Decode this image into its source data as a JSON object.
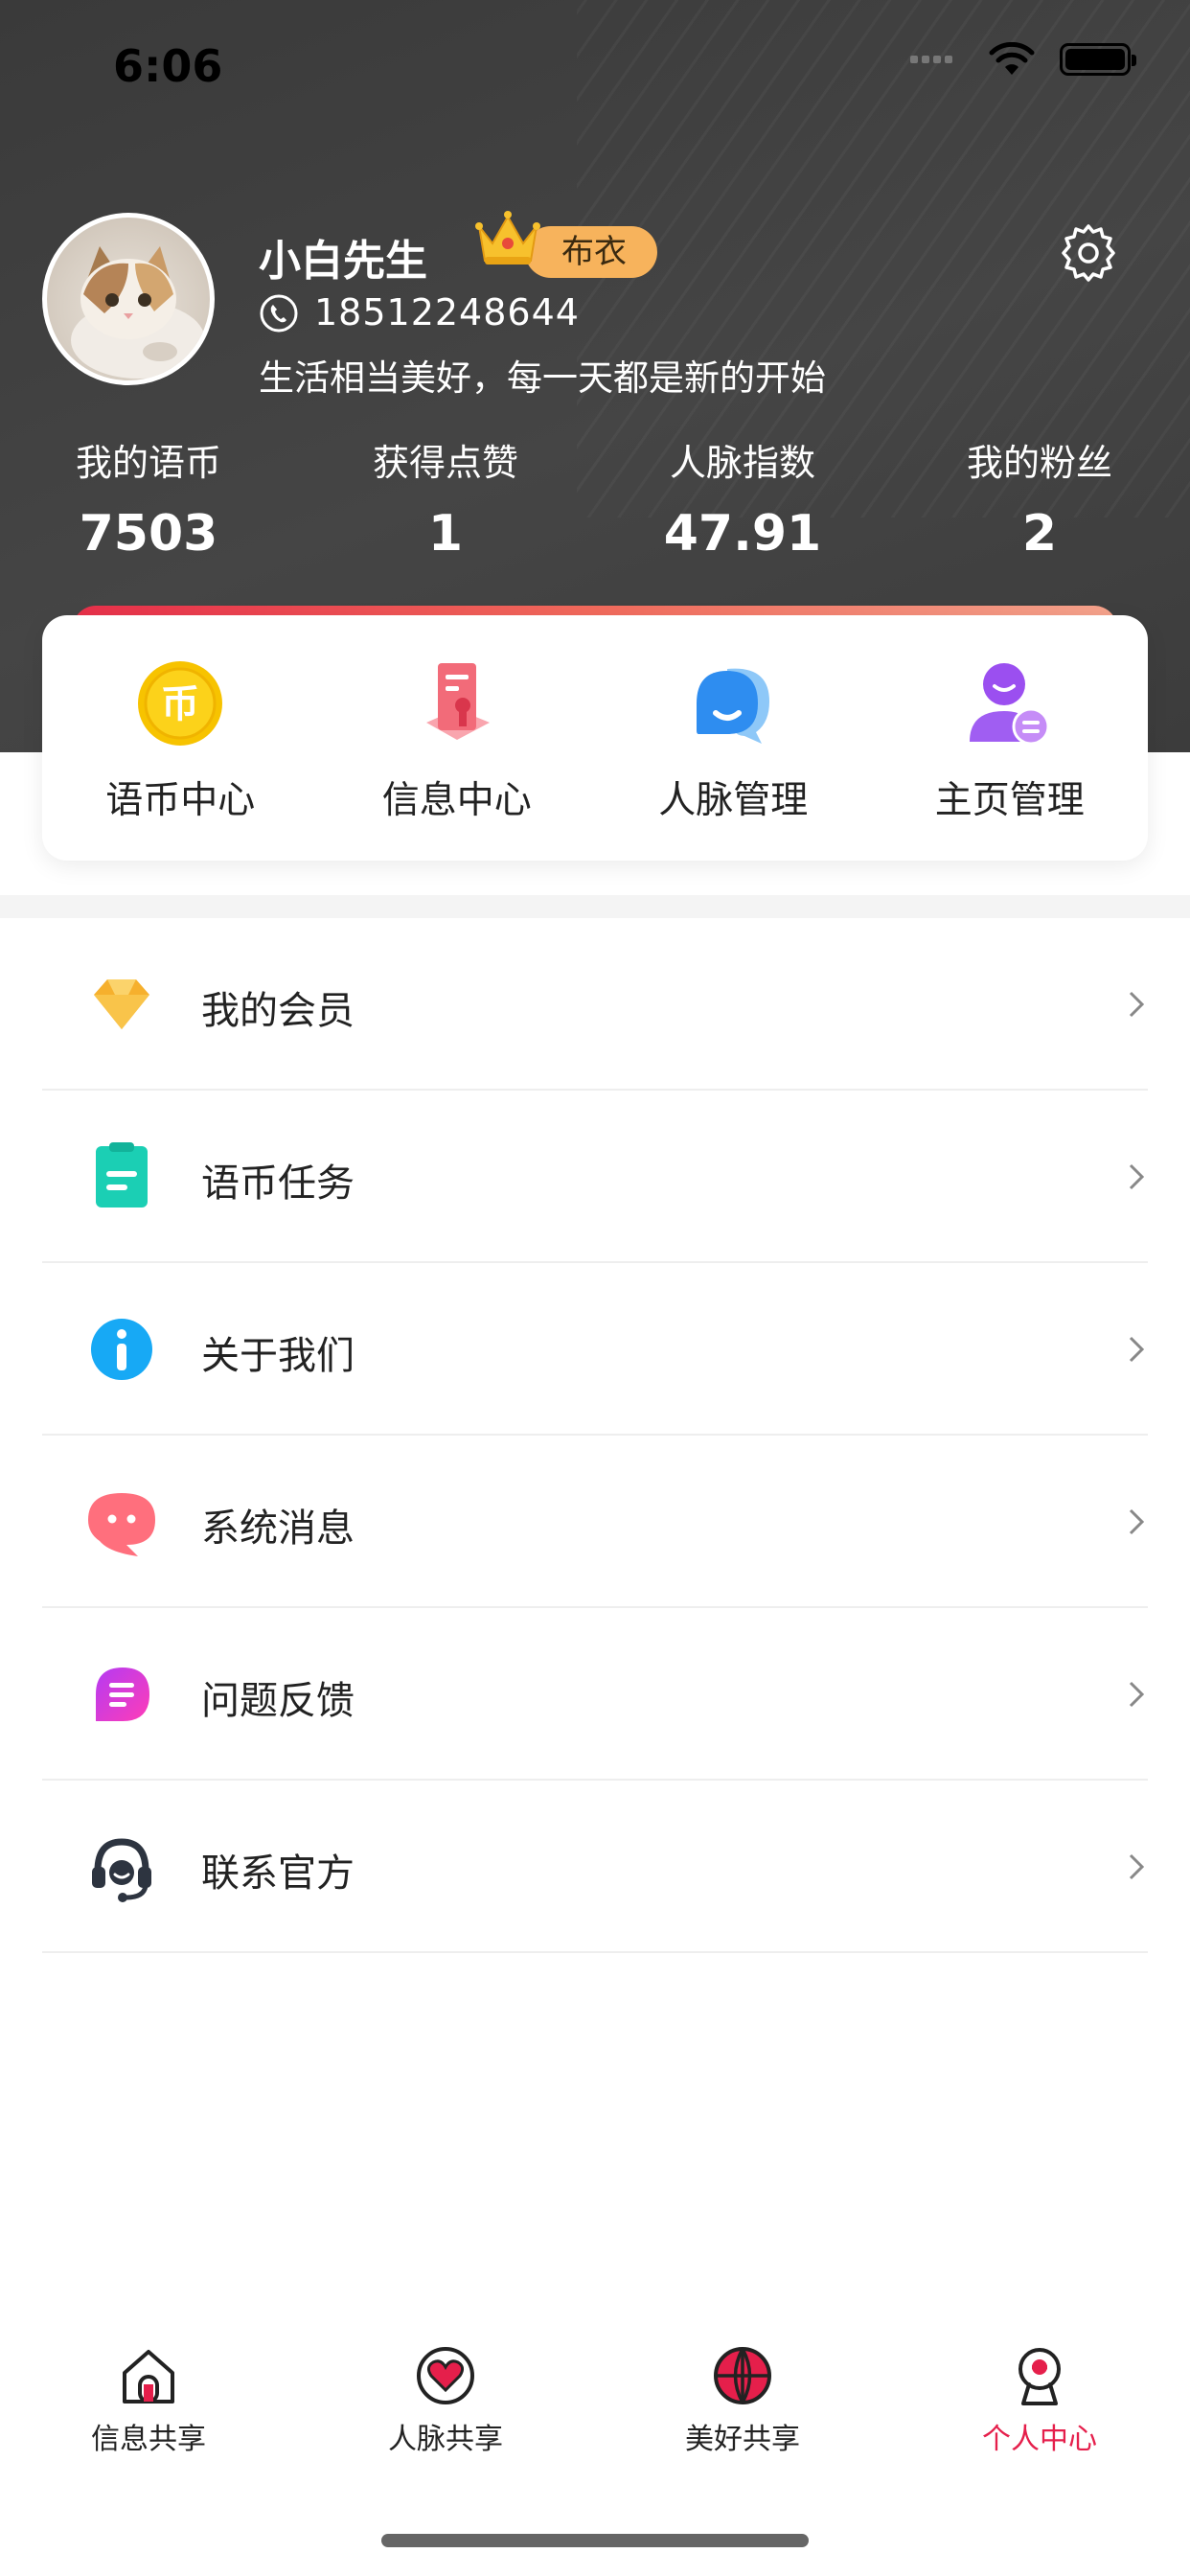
{
  "status_bar": {
    "time": "6:06"
  },
  "profile": {
    "name": "小白先生",
    "level_badge": "布衣",
    "phone": "18512248644",
    "bio": "生活相当美好，每一天都是新的开始"
  },
  "stats": [
    {
      "label": "我的语币",
      "value": "7503"
    },
    {
      "label": "获得点赞",
      "value": "1"
    },
    {
      "label": "人脉指数",
      "value": "47.91"
    },
    {
      "label": "我的粉丝",
      "value": "2"
    }
  ],
  "quick_actions": [
    {
      "label": "语币中心",
      "icon": "coin-icon",
      "icon_glyph": "币"
    },
    {
      "label": "信息中心",
      "icon": "document-icon"
    },
    {
      "label": "人脉管理",
      "icon": "chat-bubbles-icon"
    },
    {
      "label": "主页管理",
      "icon": "user-manage-icon"
    }
  ],
  "menu": [
    {
      "label": "我的会员",
      "icon": "diamond-icon",
      "color": "#f6b02d"
    },
    {
      "label": "语币任务",
      "icon": "clipboard-icon",
      "color": "#1bcfb4"
    },
    {
      "label": "关于我们",
      "icon": "info-icon",
      "color": "#17a9f5"
    },
    {
      "label": "系统消息",
      "icon": "message-icon",
      "color": "#ff6f7d"
    },
    {
      "label": "问题反馈",
      "icon": "feedback-icon",
      "color": "#d12cf0"
    },
    {
      "label": "联系官方",
      "icon": "headset-icon",
      "color": "#2d3440"
    }
  ],
  "tabbar": [
    {
      "label": "信息共享",
      "icon": "home-icon",
      "active": false
    },
    {
      "label": "人脉共享",
      "icon": "heart-icon",
      "active": false
    },
    {
      "label": "美好共享",
      "icon": "globe-icon",
      "active": false
    },
    {
      "label": "个人中心",
      "icon": "profile-icon",
      "active": true
    }
  ],
  "colors": {
    "accent": "#e51f4b",
    "header_bg": "#404040",
    "badge": "#f7b35c"
  }
}
